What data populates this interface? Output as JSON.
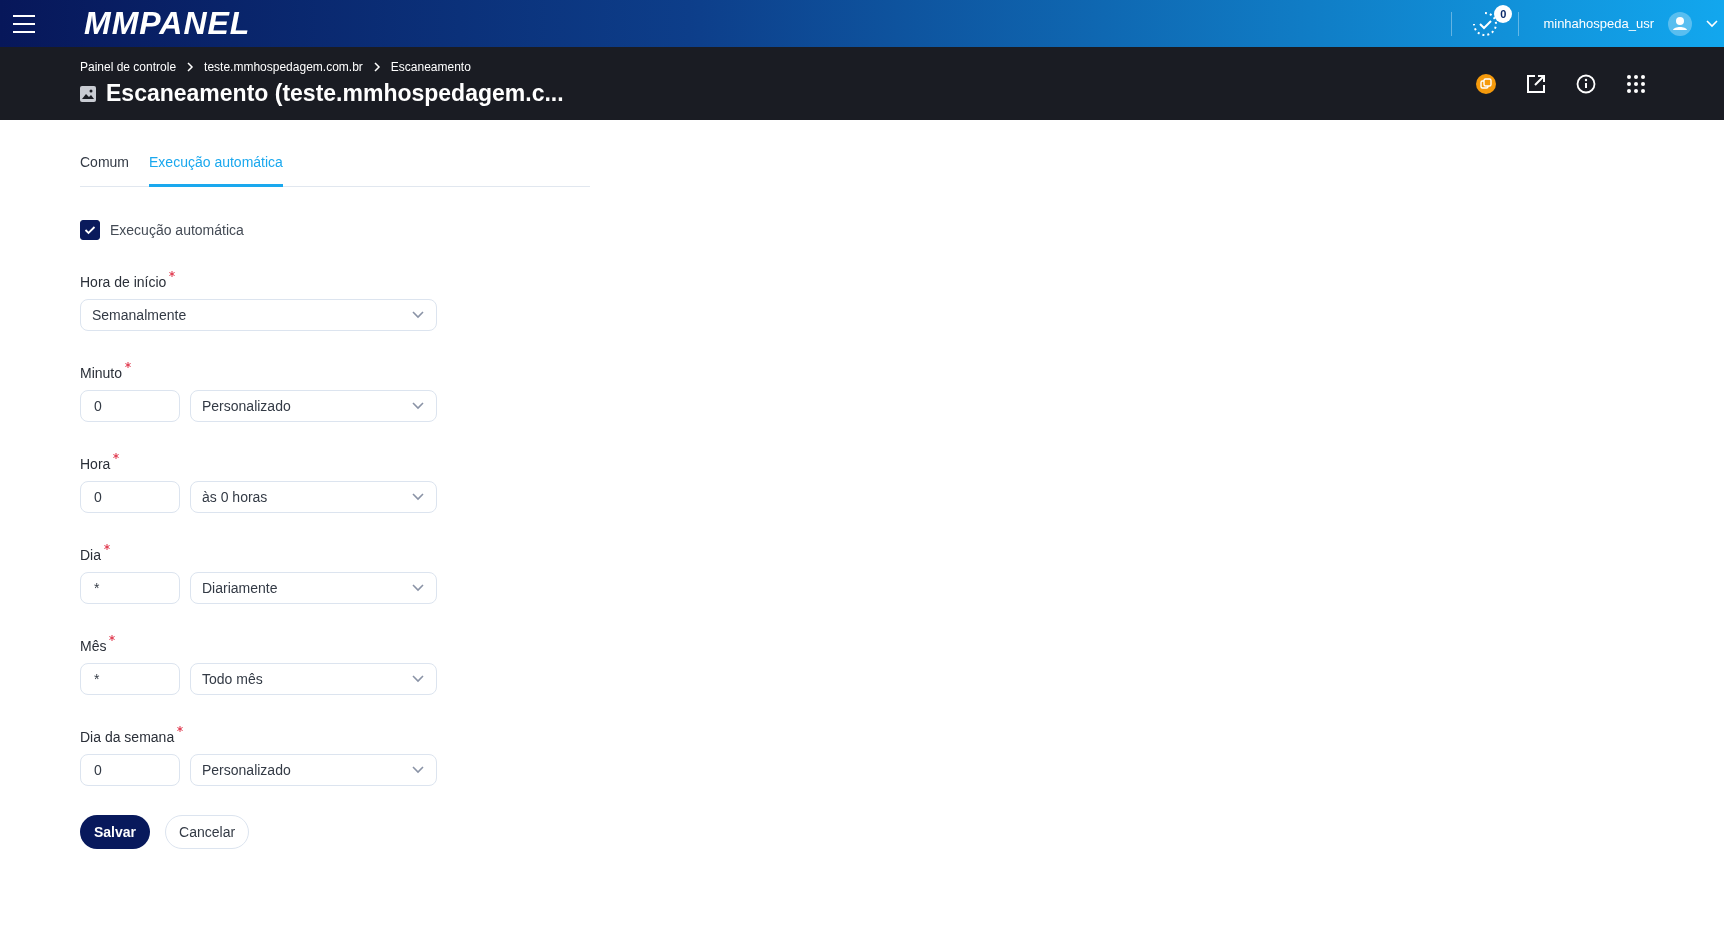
{
  "topbar": {
    "logo": "MMPANEL",
    "tasks_count": "0",
    "username": "minhahospeda_usr"
  },
  "header": {
    "breadcrumbs": [
      "Painel de controle",
      "teste.mmhospedagem.com.br",
      "Escaneamento"
    ],
    "title": "Escaneamento (teste.mmhospedagem.c..."
  },
  "tabs": [
    {
      "label": "Comum",
      "selected": false
    },
    {
      "label": "Execução automática",
      "selected": true
    }
  ],
  "auto_run": {
    "label": "Execução automática",
    "checked": true
  },
  "start_time": {
    "label": "Hora de início",
    "required": true,
    "value": "Semanalmente"
  },
  "fields": [
    {
      "label": "Minuto",
      "required": true,
      "value": "0",
      "select": "Personalizado"
    },
    {
      "label": "Hora",
      "required": true,
      "value": "0",
      "select": "às 0 horas"
    },
    {
      "label": "Dia",
      "required": true,
      "value": "*",
      "select": "Diariamente"
    },
    {
      "label": "Mês",
      "required": true,
      "value": "*",
      "select": "Todo mês"
    },
    {
      "label": "Dia da semana",
      "required": true,
      "value": "0",
      "select": "Personalizado"
    }
  ],
  "buttons": {
    "save": "Salvar",
    "cancel": "Cancelar"
  }
}
